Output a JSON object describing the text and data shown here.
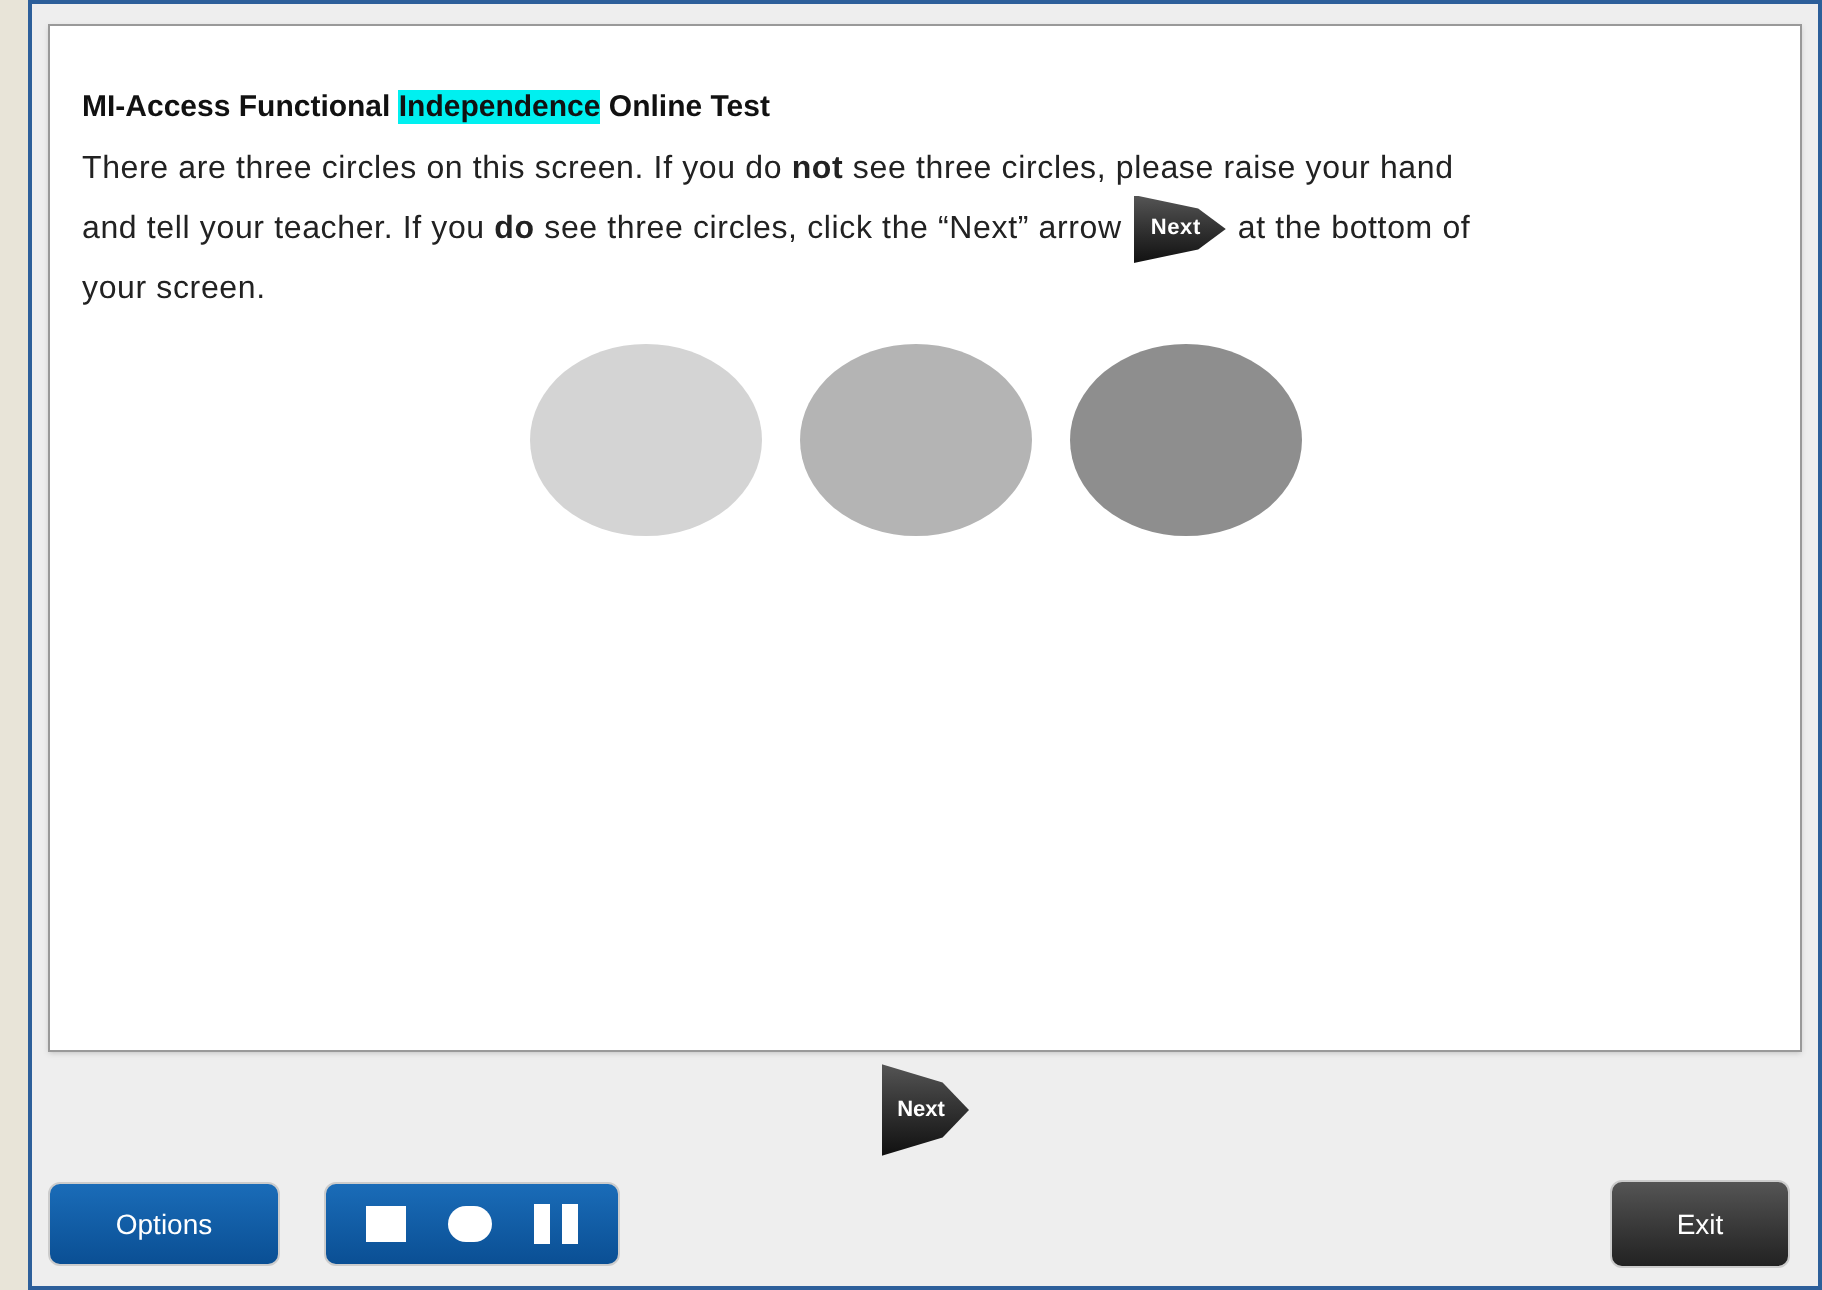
{
  "title": [
    {
      "text": "MI-Access Functional ",
      "highlighted": false
    },
    {
      "text": "Independence",
      "highlighted": true
    },
    {
      "text": " Online Test",
      "highlighted": false
    }
  ],
  "instruction_lines": [
    {
      "text": "There are three circles on this screen. If you do **not** see three circles, please raise your hand"
    },
    {
      "text": "and tell your teacher. If you **do** see three circles, click the “Next” arrow",
      "arrow_label": "Next",
      "after": "at the bottom of"
    },
    {
      "text": "your screen."
    }
  ],
  "next_button": {
    "label": "Next"
  },
  "options_button": {
    "label": "Options"
  },
  "media_controls": [
    {
      "kind": "stop"
    },
    {
      "kind": "record"
    },
    {
      "kind": "pause"
    }
  ],
  "exit_button": {
    "label": "Exit"
  }
}
